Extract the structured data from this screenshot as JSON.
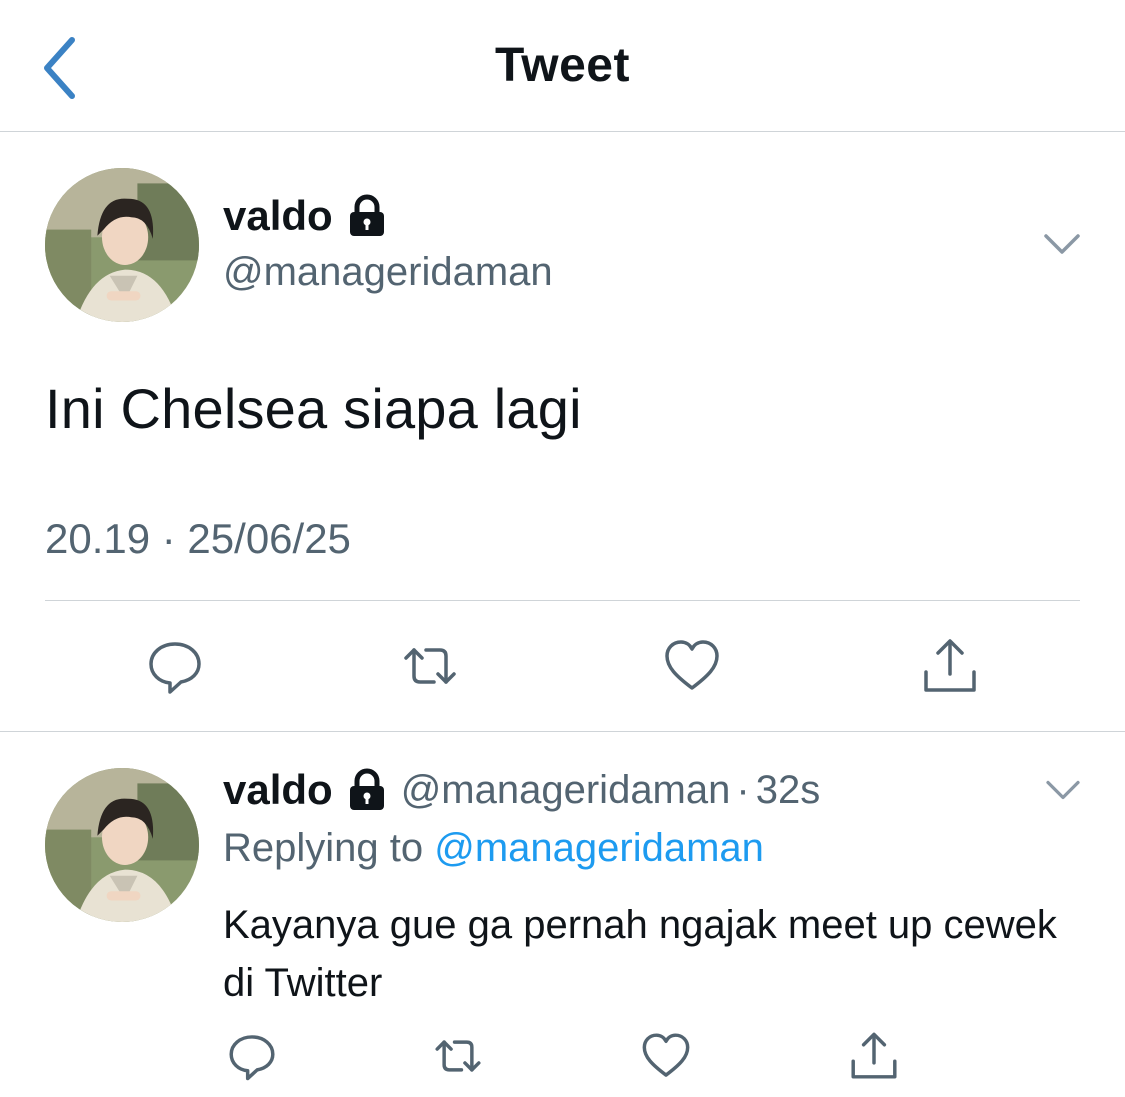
{
  "header": {
    "title": "Tweet",
    "back_icon": "chevron-left-icon"
  },
  "colors": {
    "accent": "#1d9bf0",
    "back_arrow": "#3b82c4",
    "secondary_text": "#536471",
    "divider": "#cfd4d8"
  },
  "main_tweet": {
    "display_name": "valdo",
    "handle": "@manageridaman",
    "protected_icon": "lock-icon",
    "text": "Ini Chelsea siapa lagi",
    "timestamp": "20.19 · 25/06/25",
    "actions": [
      "reply-icon",
      "retweet-icon",
      "like-icon",
      "share-icon"
    ]
  },
  "reply_tweet": {
    "display_name": "valdo",
    "handle": "@manageridaman",
    "separator": "·",
    "time_ago": "32s",
    "replying_prefix": "Replying to",
    "replying_to": "@manageridaman",
    "text": "Kayanya gue ga pernah ngajak meet up cewek di Twitter",
    "actions": [
      "reply-icon",
      "retweet-icon",
      "like-icon",
      "share-icon"
    ]
  }
}
